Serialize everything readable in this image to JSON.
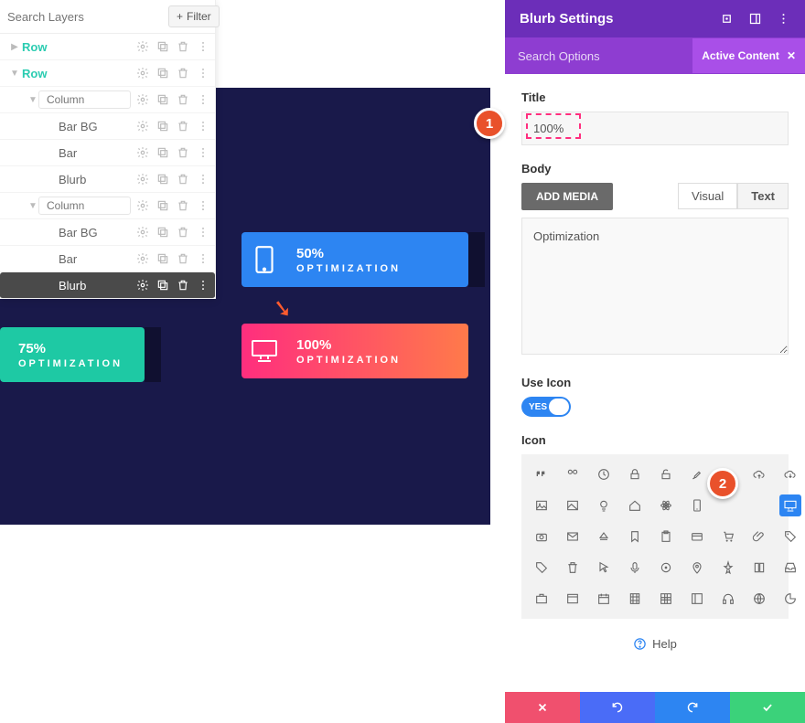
{
  "layers": {
    "search_placeholder": "Search Layers",
    "filter_label": "Filter",
    "items": [
      {
        "label": "Row",
        "kind": "row",
        "depth": 0,
        "caret": "▶"
      },
      {
        "label": "Row",
        "kind": "row",
        "depth": 0,
        "caret": "▼"
      },
      {
        "label": "Column",
        "kind": "column",
        "depth": 1,
        "caret": "▼"
      },
      {
        "label": "Bar BG",
        "kind": "child",
        "depth": 2
      },
      {
        "label": "Bar",
        "kind": "child",
        "depth": 2
      },
      {
        "label": "Blurb",
        "kind": "child",
        "depth": 2
      },
      {
        "label": "Column",
        "kind": "column",
        "depth": 1,
        "caret": "▼"
      },
      {
        "label": "Bar BG",
        "kind": "child",
        "depth": 2
      },
      {
        "label": "Bar",
        "kind": "child",
        "depth": 2
      },
      {
        "label": "Blurb",
        "kind": "child",
        "depth": 2,
        "active": true
      }
    ]
  },
  "canvas": {
    "cards": [
      {
        "pct": "75%",
        "cap": "OPTIMIZATION",
        "variant": "teal"
      },
      {
        "pct": "50%",
        "cap": "OPTIMIZATION",
        "variant": "blue",
        "icon": "tablet"
      },
      {
        "pct": "100%",
        "cap": "OPTIMIZATION",
        "variant": "pink",
        "icon": "desktop"
      }
    ]
  },
  "callouts": {
    "one": "1",
    "two": "2"
  },
  "settings": {
    "header_title": "Blurb Settings",
    "search_placeholder": "Search Options",
    "active_content_label": "Active Content",
    "title_label": "Title",
    "title_value": "100%",
    "body_label": "Body",
    "add_media_label": "ADD MEDIA",
    "tab_visual": "Visual",
    "tab_text": "Text",
    "body_value": "Optimization",
    "use_icon_label": "Use Icon",
    "use_icon_value": "YES",
    "icon_label": "Icon",
    "help_label": "Help"
  },
  "icon_grid": [
    "quote",
    "quote-right",
    "clock",
    "lock",
    "unlock",
    "brush",
    "cloud",
    "cloud-up",
    "cloud-down",
    "image",
    "image-alt",
    "bulb",
    "home",
    "gear-atom",
    "tablet",
    "blank",
    "blank",
    "desktop",
    "camera-bag",
    "mail",
    "eject",
    "bookmark",
    "clipboard",
    "card",
    "cart",
    "attach",
    "tag",
    "tag2",
    "trash",
    "cursor",
    "mic",
    "target",
    "pin-o",
    "pin",
    "book",
    "inbox",
    "briefcase",
    "window",
    "calendar",
    "film",
    "grid",
    "panel",
    "headphones",
    "globe",
    "pie"
  ],
  "icon_selected_index": 17
}
